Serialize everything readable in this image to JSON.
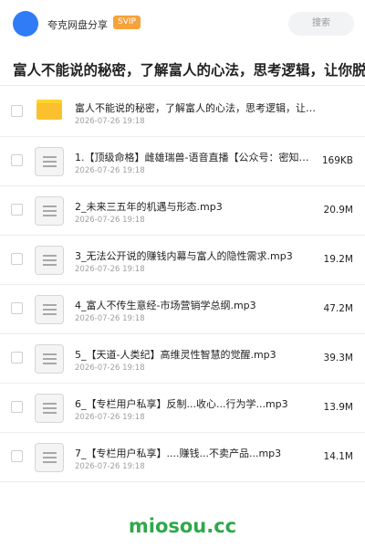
{
  "header": {
    "app_name": "夸克网盘分享",
    "badge": "SVIP",
    "search_placeholder": "搜索"
  },
  "folder_title": "富人不能说的秘密，了解富人的心法，思考逻辑，让你脱贫",
  "files": [
    {
      "type": "folder",
      "name": "富人不能说的秘密，了解富人的心法，思考逻辑，让你脱贫",
      "date": "2026-07-26 19:18",
      "size": ""
    },
    {
      "type": "file",
      "name": "1.【顶级命格】雌雄瑞兽-语音直播【公众号：密知圈】.mp3",
      "date": "2026-07-26 19:18",
      "size": "169KB"
    },
    {
      "type": "file",
      "name": "2_未来三五年的机遇与形态.mp3",
      "date": "2026-07-26 19:18",
      "size": "20.9M"
    },
    {
      "type": "file",
      "name": "3_无法公开说的赚钱内幕与富人的隐性需求.mp3",
      "date": "2026-07-26 19:18",
      "size": "19.2M"
    },
    {
      "type": "file",
      "name": "4_富人不传生意经-市场营销学总纲.mp3",
      "date": "2026-07-26 19:18",
      "size": "47.2M"
    },
    {
      "type": "file",
      "name": "5_【天道-人类纪】高维灵性智慧的觉醒.mp3",
      "date": "2026-07-26 19:18",
      "size": "39.3M"
    },
    {
      "type": "file",
      "name": "6_【专栏用户私享】反制...收心...行为学...mp3",
      "date": "2026-07-26 19:18",
      "size": "13.9M"
    },
    {
      "type": "file",
      "name": "7_【专栏用户私享】....赚钱...不卖产品...mp3",
      "date": "2026-07-26 19:18",
      "size": "14.1M"
    }
  ],
  "watermark": "miosou.cc",
  "colors": {
    "accent": "#2f7cf6",
    "svip": "#f7a23b",
    "folder": "#fbc02d",
    "watermark": "#2fa84a"
  }
}
